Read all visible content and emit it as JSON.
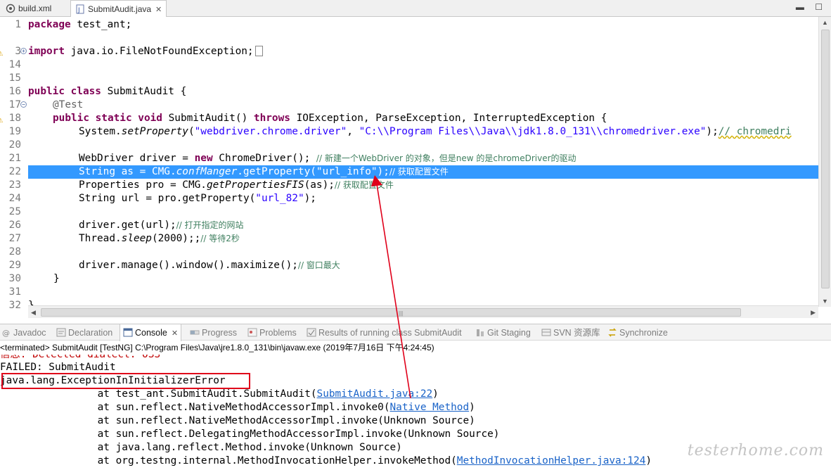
{
  "editor_tabs": [
    {
      "label": "build.xml",
      "icon": "xml-file-icon",
      "active": false
    },
    {
      "label": "SubmitAudit.java",
      "icon": "java-file-icon",
      "active": true,
      "close": "✕"
    }
  ],
  "window_controls": "▬ ☐",
  "code": {
    "l1": {
      "num": "1",
      "kw": "package",
      "rest": " test_ant;"
    },
    "l3": {
      "num": "3",
      "kw": "import",
      "rest": " java.io.FileNotFoundException;"
    },
    "l14": {
      "num": "14"
    },
    "l15": {
      "num": "15"
    },
    "l16": {
      "num": "16",
      "kw": "public class",
      "rest": " SubmitAudit {"
    },
    "l17": {
      "num": "17",
      "annotation": "@Test"
    },
    "l18": {
      "num": "18",
      "kw1": "public static void",
      "mid": " SubmitAudit() ",
      "kw2": "throws",
      "rest": " IOException, ParseException, InterruptedException {"
    },
    "l19": {
      "num": "19",
      "a": "System.",
      "method": "setProperty",
      "b": "(",
      "s1": "\"webdriver.chrome.driver\"",
      "c": ", ",
      "s2": "\"C:\\\\Program Files\\\\Java\\\\jdk1.8.0_131\\\\chromedriver.exe\"",
      "d": ");",
      "cmt": "// chromedri"
    },
    "l20": {
      "num": "20"
    },
    "l21": {
      "num": "21",
      "a": "WebDriver ",
      "var": "driver",
      "b": " = ",
      "kw": "new",
      "c": " ChromeDriver(); ",
      "cmt": "// 新建一个WebDriver 的对象，但是new 的是chromeDriver的驱动"
    },
    "l22": {
      "num": "22",
      "a": "String as = CMG.",
      "fld": "confManger",
      "b": ".getProperty(\"url_info\");",
      "cmt": "// 获取配置文件"
    },
    "l23": {
      "num": "23",
      "a": "Properties ",
      "var": "pro",
      "b": " = CMG.",
      "method": "getPropertiesFIS",
      "c": "(as);",
      "cmt": "// 获取配置文件"
    },
    "l24": {
      "num": "24",
      "a": "String ",
      "var": "url",
      "b": " = ",
      "var2": "pro",
      "c": ".getProperty(",
      "s": "\"url_82\"",
      "d": ");"
    },
    "l25": {
      "num": "25"
    },
    "l26": {
      "num": "26",
      "var": "driver",
      "a": ".get(",
      "var2": "url",
      "b": ");",
      "cmt": "// 打开指定的网站"
    },
    "l27": {
      "num": "27",
      "a": "Thread.",
      "method": "sleep",
      "b": "(2000);;",
      "cmt": "// 等待2秒"
    },
    "l28": {
      "num": "28"
    },
    "l29": {
      "num": "29",
      "var": "driver",
      "a": ".manage().window().maximize();",
      "cmt": "// 窗口最大"
    },
    "l30": {
      "num": "30",
      "a": "}"
    },
    "l31": {
      "num": "31"
    },
    "l32": {
      "num": "32",
      "a": "}"
    }
  },
  "view_tabs": [
    {
      "label": "Javadoc",
      "icon": "javadoc-icon"
    },
    {
      "label": "Declaration",
      "icon": "declaration-icon"
    },
    {
      "label": "Console",
      "icon": "console-icon",
      "active": true,
      "close": "✕"
    },
    {
      "label": "Progress",
      "icon": "progress-icon"
    },
    {
      "label": "Problems",
      "icon": "problems-icon"
    },
    {
      "label": "Results of running class SubmitAudit",
      "icon": "testng-results-icon"
    },
    {
      "label": "Git Staging",
      "icon": "git-staging-icon"
    },
    {
      "label": "SVN 资源库",
      "icon": "svn-repository-icon"
    },
    {
      "label": "Synchronize",
      "icon": "synchronize-icon"
    }
  ],
  "console": {
    "header": "<terminated> SubmitAudit [TestNG] C:\\Program Files\\Java\\jre1.8.0_131\\bin\\javaw.exe (2019年7月16日 下午4:24:45)",
    "partial_line": "信息: Detected dialect: OSS",
    "failed": "FAILED: SubmitAudit",
    "error": "java.lang.ExceptionInInitializerError",
    "stack": [
      {
        "pre": "\tat test_ant.SubmitAudit.SubmitAudit(",
        "link": "SubmitAudit.java:22",
        "post": ")"
      },
      {
        "pre": "\tat sun.reflect.NativeMethodAccessorImpl.invoke0(",
        "link": "Native Method",
        "post": ")"
      },
      {
        "pre": "\tat sun.reflect.NativeMethodAccessorImpl.invoke(Unknown Source)",
        "link": "",
        "post": ""
      },
      {
        "pre": "\tat sun.reflect.DelegatingMethodAccessorImpl.invoke(Unknown Source)",
        "link": "",
        "post": ""
      },
      {
        "pre": "\tat java.lang.reflect.Method.invoke(Unknown Source)",
        "link": "",
        "post": ""
      },
      {
        "pre": "\tat org.testng.internal.MethodInvocationHelper.invokeMethod(",
        "link": "MethodInvocationHelper.java:124",
        "post": ")"
      }
    ]
  },
  "watermark": "testerhome.com",
  "colors": {
    "keyword": "#7f0055",
    "string": "#2a00ff",
    "comment": "#3f7f5f",
    "selection": "#3399ff",
    "annotation_red": "#e0001a"
  }
}
